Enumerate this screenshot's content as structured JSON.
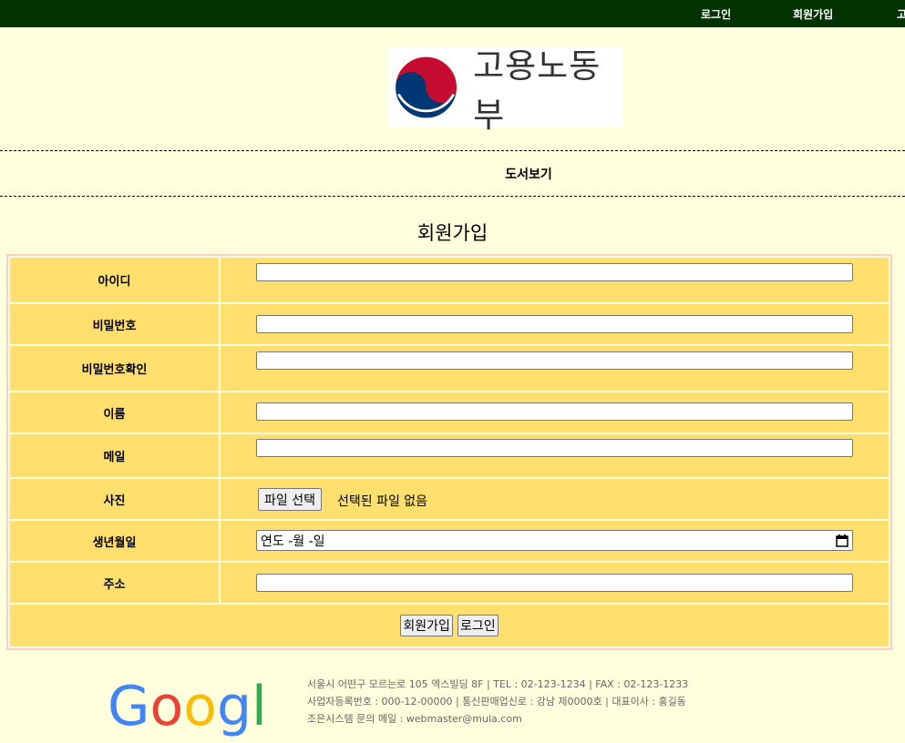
{
  "nav": {
    "login": "로그인",
    "join": "회원가입",
    "third": "고"
  },
  "logo": {
    "text": "고용노동부"
  },
  "menu": {
    "books": "도서보기"
  },
  "form": {
    "title": "회원가입",
    "labels": {
      "id": "아이디",
      "password": "비밀번호",
      "password_confirm": "비밀번호확인",
      "name": "이름",
      "email": "메일",
      "photo": "사진",
      "birth": "생년월일",
      "address": "주소"
    },
    "values": {
      "id": "",
      "password": "",
      "password_confirm": "",
      "name": "",
      "email": "",
      "address": ""
    },
    "file_button": "파일 선택",
    "file_status": "선택된 파일 없음",
    "birth_placeholder": "연도 -월 -일",
    "submit_button": "회원가입",
    "login_button": "로그인"
  },
  "footer": {
    "logo_text": "Google",
    "line1": "서울시 어떤구 모르는로 105 엑스빌딩 8F | TEL : 02-123-1234 | FAX : 02-123-1233",
    "line2": "사업자등록번호 : 000-12-00000 | 통신판매업신로 : 강남 제0000호 | 대표이사 : 홍길동",
    "line3": "조은시스템 문의 메일 : webmaster@mula.com"
  },
  "colors": {
    "topbar": "#003300",
    "page_bg": "#ffffdd",
    "form_cell": "#ffdf6e",
    "form_border": "#ffcccc"
  }
}
